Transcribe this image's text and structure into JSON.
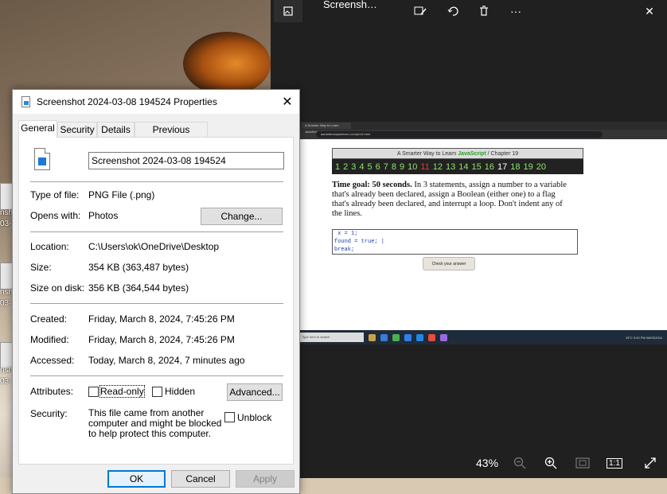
{
  "photos_app": {
    "title": "Screensh…",
    "icons": [
      "gallery-icon",
      "edit-icon",
      "rotate-icon",
      "delete-icon",
      "more-icon",
      "close-icon"
    ],
    "more_label": "···",
    "close_label": "✕",
    "zoom_label": "43%",
    "bottom_icons": [
      "zoom-out-icon",
      "zoom-in-icon",
      "fit-icon",
      "actual-size-icon",
      "fullscreen-icon"
    ],
    "actual_size_label": "1:1"
  },
  "inner_screenshot": {
    "tab_title": "A Smarter Way to Learn JavaScri…",
    "url": "asmarterwaytolearn.com/js/19.html",
    "book_header_prefix": "A Smarter Way to Learn ",
    "book_header_js": "JavaScript",
    "book_header_suffix": " / Chapter 19",
    "chapters_green": [
      "1",
      "2",
      "3",
      "4",
      "5",
      "6",
      "7",
      "8",
      "9",
      "10"
    ],
    "chapter_red": "11",
    "chapters_green2": [
      "12",
      "13",
      "14",
      "15",
      "16"
    ],
    "chapter_current": "17",
    "chapters_green3": [
      "18",
      "19",
      "20"
    ],
    "task_bold": "Time goal: 50 seconds.",
    "task_text": " In 3 statements, assign a number to a variable that's already been declared, assign a Boolean (either one) to a flag that's already been declared, and interrupt a loop. Don't indent any of the lines.",
    "code": " x = 1;\nfound = true; |\nbreak;",
    "check_button": "Check your answer",
    "taskbar_search": "Type here to search",
    "taskbar_weather": "15°C",
    "taskbar_time": "9:20 PM",
    "taskbar_date": "08/03/2024"
  },
  "dialog": {
    "title": "Screenshot 2024-03-08 194524 Properties",
    "close_label": "✕",
    "tabs": [
      "General",
      "Security",
      "Details",
      "Previous Versions"
    ],
    "file_name": "Screenshot 2024-03-08 194524",
    "type_of_file_label": "Type of file:",
    "type_of_file": "PNG File (.png)",
    "opens_with_label": "Opens with:",
    "opens_with": "Photos",
    "change_button": "Change...",
    "location_label": "Location:",
    "location": "C:\\Users\\ok\\OneDrive\\Desktop",
    "size_label": "Size:",
    "size": "354 KB (363,487 bytes)",
    "size_on_disk_label": "Size on disk:",
    "size_on_disk": "356 KB (364,544 bytes)",
    "created_label": "Created:",
    "created": "Friday, March 8, 2024, 7:45:26 PM",
    "modified_label": "Modified:",
    "modified": "Friday, March 8, 2024, 7:45:26 PM",
    "accessed_label": "Accessed:",
    "accessed": "Today, March 8, 2024, 7 minutes ago",
    "attributes_label": "Attributes:",
    "readonly_label": "Read-only",
    "hidden_label": "Hidden",
    "advanced_button": "Advanced...",
    "security_label": "Security:",
    "security_text": "This file came from another computer and might be blocked to help protect this computer.",
    "unblock_label": "Unblock",
    "ok_button": "OK",
    "cancel_button": "Cancel",
    "apply_button": "Apply"
  },
  "desktop": {
    "icon_label_fragment": "nsh",
    "icon_label_fragment2": "03-"
  },
  "colors": {
    "dialog_bg": "#f0f0f0",
    "accent": "#0078d7",
    "photos_bg": "#202020",
    "chapter_green": "#8fe36a",
    "chapter_red": "#e03b3b",
    "javascript_green": "#2a9d2a"
  }
}
